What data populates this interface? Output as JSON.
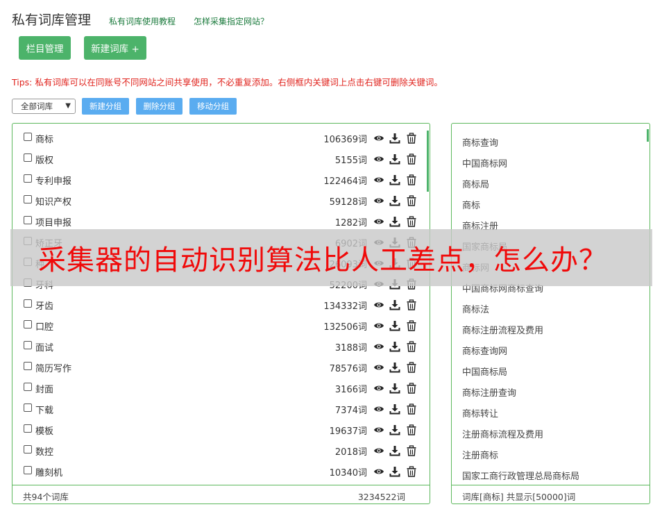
{
  "header": {
    "title": "私有词库管理",
    "link_tutorial": "私有词库使用教程",
    "link_collect": "怎样采集指定网站？"
  },
  "buttons": {
    "column_manage": "栏目管理",
    "new_library": "新建词库 +"
  },
  "tips": "Tips: 私有词库可以在同账号不同网站之间共享使用，不必重复添加。右侧框内关键词上点击右键可删除关键词。",
  "toolbar": {
    "select_value": "全部词库",
    "new_group": "新建分组",
    "delete_group": "删除分组",
    "move_group": "移动分组"
  },
  "libraries": [
    {
      "name": "商标",
      "count": "106369词"
    },
    {
      "name": "版权",
      "count": "5155词"
    },
    {
      "name": "专利申报",
      "count": "122464词"
    },
    {
      "name": "知识产权",
      "count": "59128词"
    },
    {
      "name": "项目申报",
      "count": "1282词"
    },
    {
      "name": "矫正牙",
      "count": "6902词"
    },
    {
      "name": "种",
      "count": "26093词"
    },
    {
      "name": "牙科",
      "count": "52200词"
    },
    {
      "name": "牙齿",
      "count": "134332词"
    },
    {
      "name": "口腔",
      "count": "132506词"
    },
    {
      "name": "面试",
      "count": "3188词"
    },
    {
      "name": "简历写作",
      "count": "78576词"
    },
    {
      "name": "封面",
      "count": "3166词"
    },
    {
      "name": "下载",
      "count": "7374词"
    },
    {
      "name": "模板",
      "count": "19637词"
    },
    {
      "name": "数控",
      "count": "2018词"
    },
    {
      "name": "雕刻机",
      "count": "10340词"
    }
  ],
  "left_footer": {
    "total_libraries": "共94个词库",
    "total_words": "3234522词"
  },
  "keywords": [
    "商标查询",
    "中国商标网",
    "商标局",
    "商标",
    "商标注册",
    "国家商标局",
    "商标网",
    "中国商标网商标查询",
    "商标法",
    "商标注册流程及费用",
    "商标查询网",
    "中国商标局",
    "商标注册查询",
    "商标转让",
    "注册商标流程及费用",
    "注册商标",
    "国家工商行政管理总局商标局"
  ],
  "right_footer": "词库[商标] 共显示[50000]词",
  "overlay_text": "采集器的自动识别算法比人工差点，怎么办？",
  "colors": {
    "green_button": "#4cb36a",
    "blue_button": "#5aacf0",
    "tips_red": "#e0231d",
    "overlay_red": "#f00a0a",
    "panel_border": "#5cb85c"
  },
  "icons": [
    "eye-icon",
    "download-icon",
    "trash-icon",
    "chevron-down-icon"
  ]
}
